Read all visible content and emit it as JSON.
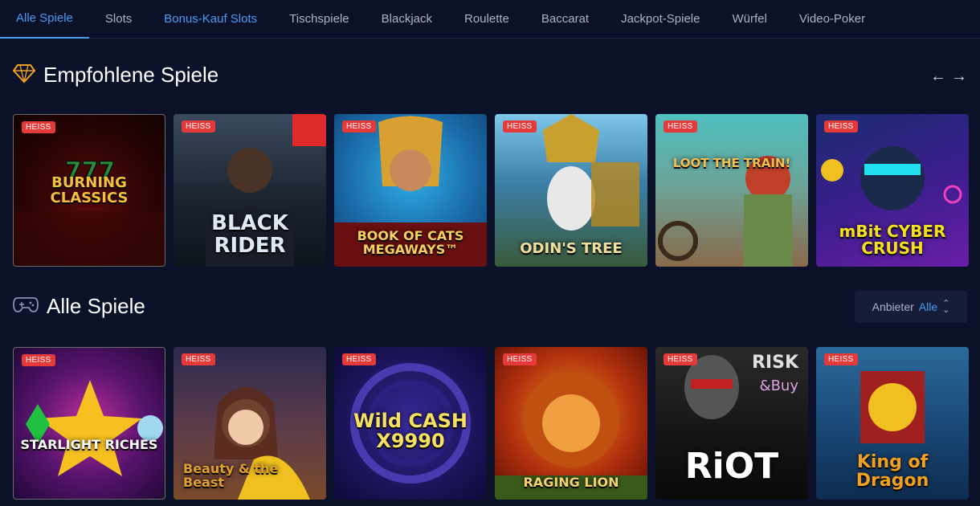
{
  "tabs": [
    {
      "label": "Alle Spiele"
    },
    {
      "label": "Slots"
    },
    {
      "label": "Bonus-Kauf Slots"
    },
    {
      "label": "Tischspiele"
    },
    {
      "label": "Blackjack"
    },
    {
      "label": "Roulette"
    },
    {
      "label": "Baccarat"
    },
    {
      "label": "Jackpot-Spiele"
    },
    {
      "label": "Würfel"
    },
    {
      "label": "Video-Poker"
    }
  ],
  "featured": {
    "title": "Empfohlene Spiele",
    "prev_icon": "arrow-left-icon",
    "next_icon": "arrow-right-icon",
    "games": [
      {
        "badge": "HEISS",
        "name": "BURNING CLASSICS"
      },
      {
        "badge": "HEISS",
        "name": "BLACK RIDER"
      },
      {
        "badge": "HEISS",
        "name": "BOOK OF CATS MEGAWAYS™"
      },
      {
        "badge": "HEISS",
        "name": "ODIN'S TREE"
      },
      {
        "badge": "HEISS",
        "name": "LOOT THE TRAIN!"
      },
      {
        "badge": "HEISS",
        "name": "mBit CYBER CRUSH"
      }
    ]
  },
  "all_games": {
    "title": "Alle Spiele",
    "provider_label": "Anbieter",
    "provider_value": "Alle",
    "games": [
      {
        "badge": "HEISS",
        "name": "STARLIGHT RICHES"
      },
      {
        "badge": "HEISS",
        "name": "Beauty & the Beast"
      },
      {
        "badge": "HEISS",
        "name": "Wild CASH X9990"
      },
      {
        "badge": "HEISS",
        "name": "RAGING LION"
      },
      {
        "badge": "HEISS",
        "name": "RiOT"
      },
      {
        "badge": "HEISS",
        "name": "King of Dragon"
      }
    ]
  },
  "colors": {
    "background": "#0b1128",
    "accent": "#4a9cf0",
    "badge": "#e53a3a"
  }
}
